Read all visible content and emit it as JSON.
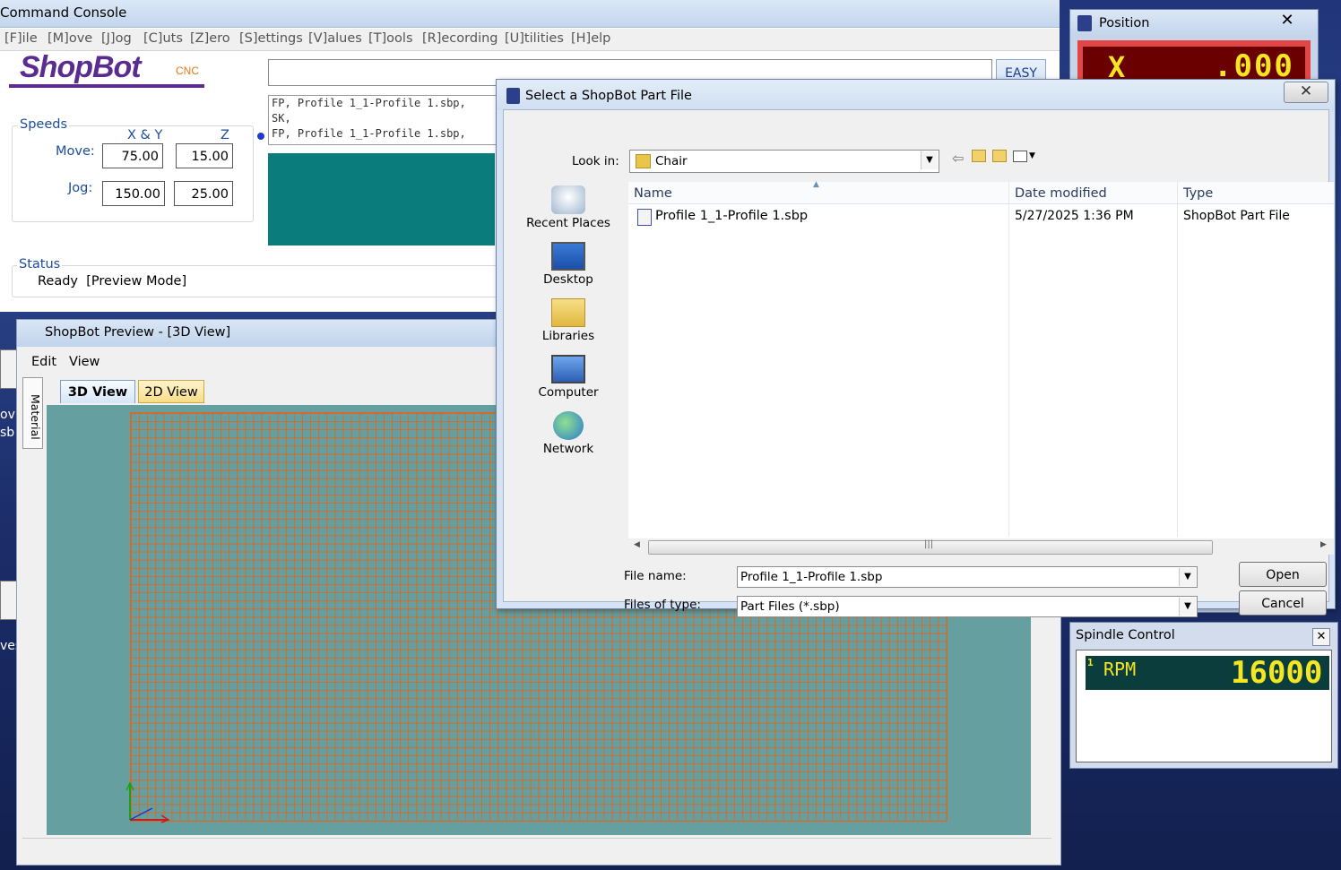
{
  "command_console": {
    "title": "Command Console",
    "menu": [
      "[F]ile",
      "[M]ove",
      "[J]og",
      "[C]uts",
      "[Z]ero",
      "[S]ettings",
      "[V]alues",
      "[T]ools",
      "[R]ecording",
      "[U]tilities",
      "[H]elp"
    ],
    "logo_text": "ShopBot",
    "logo_cnc": "CNC",
    "command_value": "",
    "easy_label": "EASY",
    "history": [
      "FP, Profile 1_1-Profile 1.sbp,",
      "SK,",
      "FP, Profile 1_1-Profile 1.sbp,"
    ],
    "speeds": {
      "title": "Speeds",
      "col_xy": "X & Y",
      "col_z": "Z",
      "move_label": "Move:",
      "jog_label": "Jog:",
      "move_xy": "75.00",
      "move_z": "15.00",
      "jog_xy": "150.00",
      "jog_z": "25.00"
    },
    "status": {
      "title": "Status",
      "text": "Ready  [Preview Mode]"
    }
  },
  "preview": {
    "title": "ShopBot Preview - [3D View]",
    "menu": [
      "Edit",
      "View"
    ],
    "side_tab": "Material",
    "tabs": [
      "3D View",
      "2D View"
    ],
    "active_tab": "3D View"
  },
  "desktop": {
    "icon_labels": [
      "ov",
      "sb",
      "ves"
    ]
  },
  "position": {
    "title": "Position",
    "axis": "X",
    "value": ".000"
  },
  "spindle": {
    "title": "Spindle Control",
    "index": "1",
    "unit": "RPM",
    "value": "16000"
  },
  "dialog": {
    "title": "Select a ShopBot Part File",
    "look_in_label": "Look in:",
    "look_in_value": "Chair",
    "places": [
      "Recent Places",
      "Desktop",
      "Libraries",
      "Computer",
      "Network"
    ],
    "columns": [
      "Name",
      "Date modified",
      "Type"
    ],
    "files": [
      {
        "name": "Profile 1_1-Profile 1.sbp",
        "date": "5/27/2025 1:36 PM",
        "type": "ShopBot Part File"
      }
    ],
    "file_name_label": "File name:",
    "file_name_value": "Profile 1_1-Profile 1.sbp",
    "file_type_label": "Files of type:",
    "file_type_value": "Part Files (*.sbp)",
    "open_label": "Open",
    "cancel_label": "Cancel"
  },
  "colors": {
    "accent": "#5a2c8f",
    "teal": "#0a7c7c",
    "grid": "#d36b2c",
    "led": "#f5e623"
  }
}
